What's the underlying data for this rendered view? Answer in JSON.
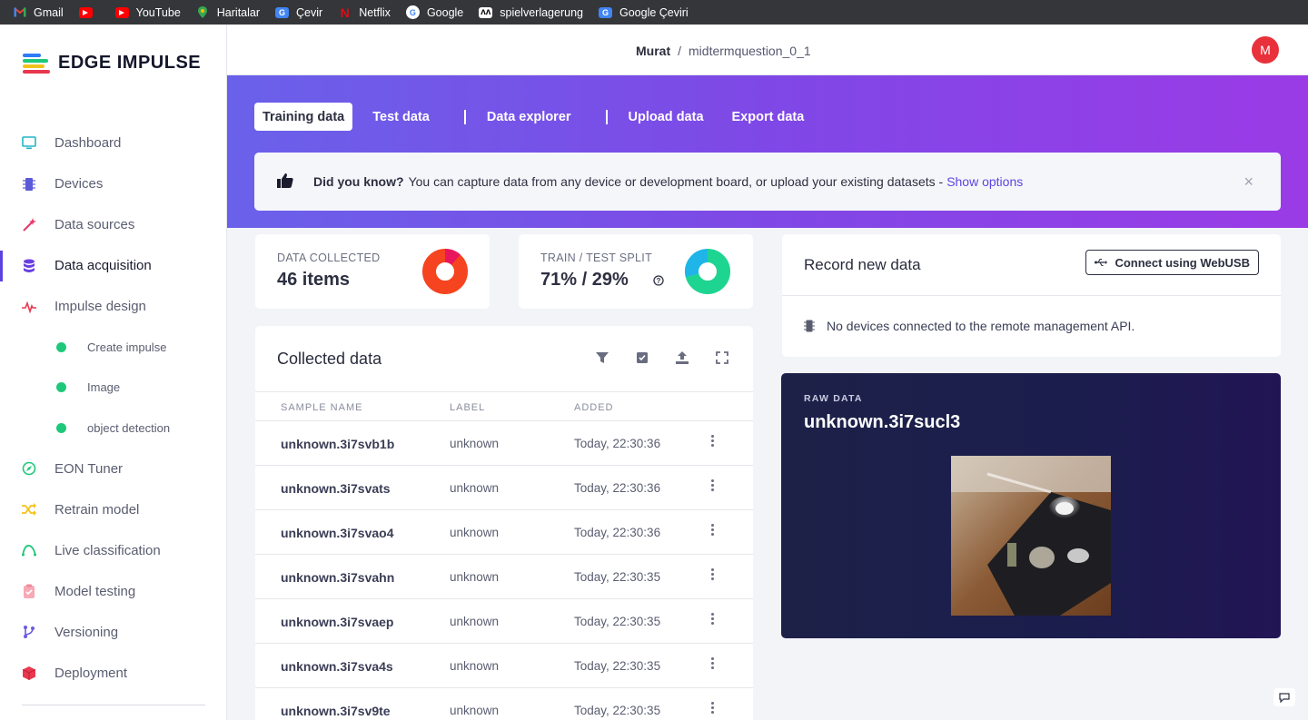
{
  "bookmarks": [
    {
      "label": "Gmail",
      "icon": "gmail-icon",
      "color": "#d93025"
    },
    {
      "label": "",
      "icon": "youtube-icon",
      "color": "#ff0000"
    },
    {
      "label": "YouTube",
      "icon": "youtube-icon",
      "color": "#ff0000"
    },
    {
      "label": "Haritalar",
      "icon": "maps-pin-icon",
      "color": "#34a853"
    },
    {
      "label": "Çevir",
      "icon": "translate-icon",
      "color": "#4285f4"
    },
    {
      "label": "Netflix",
      "icon": "netflix-icon",
      "color": "#e50914"
    },
    {
      "label": "Google",
      "icon": "google-icon",
      "color": "#4285f4"
    },
    {
      "label": "spielverlagerung",
      "icon": "spielverlagerung-icon",
      "color": "#ffffff"
    },
    {
      "label": "Google Çeviri",
      "icon": "translate-icon",
      "color": "#4285f4"
    }
  ],
  "brand": {
    "name": "EDGE IMPULSE"
  },
  "sidebar": {
    "items": [
      {
        "label": "Dashboard",
        "icon": "monitor-icon",
        "color": "#22b5c9"
      },
      {
        "label": "Devices",
        "icon": "chip-icon",
        "color": "#5a5bd6"
      },
      {
        "label": "Data sources",
        "icon": "magic-wand-icon",
        "color": "#e8386a"
      },
      {
        "label": "Data acquisition",
        "icon": "database-icon",
        "color": "#6a3fe0"
      },
      {
        "label": "Impulse design",
        "icon": "pulse-icon",
        "color": "#e8384f"
      },
      {
        "label": "Create impulse",
        "sub": true
      },
      {
        "label": "Image",
        "sub": true
      },
      {
        "label": "object detection",
        "sub": true
      },
      {
        "label": "EON Tuner",
        "icon": "compass-icon",
        "color": "#1ec87a"
      },
      {
        "label": "Retrain model",
        "icon": "shuffle-icon",
        "color": "#f2c21b"
      },
      {
        "label": "Live classification",
        "icon": "curve-icon",
        "color": "#1ec87a"
      },
      {
        "label": "Model testing",
        "icon": "clipboard-check-icon",
        "color": "#f08a9a"
      },
      {
        "label": "Versioning",
        "icon": "branch-icon",
        "color": "#6a5be0"
      },
      {
        "label": "Deployment",
        "icon": "box-icon",
        "color": "#e8384f"
      }
    ]
  },
  "header": {
    "owner": "Murat",
    "separator": "/",
    "project": "midtermquestion_0_1",
    "avatar_letter": "M"
  },
  "tabs": [
    {
      "label": "Training data",
      "active": true
    },
    {
      "label": "Test data"
    },
    {
      "label": "Data explorer"
    },
    {
      "label": "Upload data"
    },
    {
      "label": "Export data"
    }
  ],
  "tip": {
    "bold": "Did you know?",
    "text": "You can capture data from any device or development board, or upload your existing datasets -",
    "link": "Show options",
    "close": "×"
  },
  "stats": {
    "collected_label": "DATA COLLECTED",
    "collected_value": "46 items",
    "split_label": "TRAIN / TEST SPLIT",
    "split_value": "71% / 29%",
    "split_train_fraction": 0.71,
    "colors": {
      "collected": "#f5441f",
      "collected_accent": "#e8175d",
      "train": "#1ed491",
      "test": "#1fb5e9"
    }
  },
  "collected": {
    "title": "Collected data",
    "tools": [
      "filter-icon",
      "checkbox-icon",
      "upload-icon",
      "expand-icon"
    ],
    "columns": [
      "SAMPLE NAME",
      "LABEL",
      "ADDED"
    ],
    "rows": [
      {
        "name": "unknown.3i7svb1b",
        "label": "unknown",
        "added": "Today, 22:30:36"
      },
      {
        "name": "unknown.3i7svats",
        "label": "unknown",
        "added": "Today, 22:30:36"
      },
      {
        "name": "unknown.3i7svao4",
        "label": "unknown",
        "added": "Today, 22:30:36"
      },
      {
        "name": "unknown.3i7svahn",
        "label": "unknown",
        "added": "Today, 22:30:35"
      },
      {
        "name": "unknown.3i7svaep",
        "label": "unknown",
        "added": "Today, 22:30:35"
      },
      {
        "name": "unknown.3i7sva4s",
        "label": "unknown",
        "added": "Today, 22:30:35"
      },
      {
        "name": "unknown.3i7sv9te",
        "label": "unknown",
        "added": "Today, 22:30:35"
      }
    ]
  },
  "record": {
    "title": "Record new data",
    "button": "Connect using WebUSB",
    "no_devices": "No devices connected to the remote management API."
  },
  "raw": {
    "label": "RAW DATA",
    "name": "unknown.3i7sucl3"
  }
}
